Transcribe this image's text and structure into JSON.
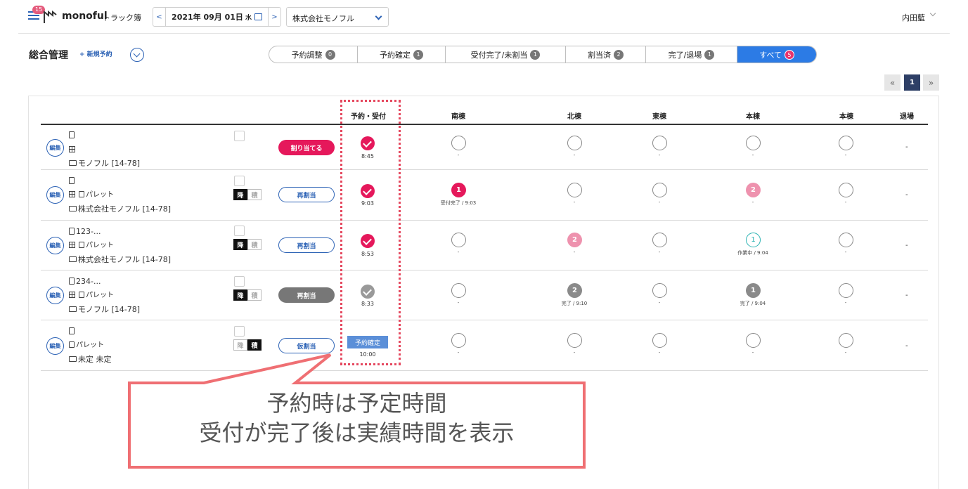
{
  "header": {
    "notification_count": "15",
    "brand": "monoful",
    "brand_sub": "トラック簿",
    "date_prev": "<",
    "date_next": ">",
    "date": "2021年 09月 01日",
    "weekday": "水",
    "company": "株式会社モノフル",
    "user": "内田藍"
  },
  "toolbar": {
    "title": "総合管理",
    "new_reservation": "+ 新規予約"
  },
  "tabs": [
    {
      "label": "予約調整",
      "count": "0"
    },
    {
      "label": "予約確定",
      "count": "1"
    },
    {
      "label": "受付完了/未割当",
      "count": "1"
    },
    {
      "label": "割当済",
      "count": "2"
    },
    {
      "label": "完了/退場",
      "count": "1"
    },
    {
      "label": "すべて",
      "count": "5"
    }
  ],
  "pager": {
    "first": "«",
    "current": "1",
    "last": "»"
  },
  "columns": [
    "予約・受付",
    "南棟",
    "北棟",
    "東棟",
    "本棟",
    "本棟",
    "退場"
  ],
  "rows": [
    {
      "edit": "編集",
      "doc": "",
      "grid": "",
      "pallet": "",
      "company": "モノフル [14-78]",
      "action": "割り当てる",
      "reception_time": "8:45",
      "cells": [
        {
          "status": "",
          "sub": "-"
        },
        {
          "status": "",
          "sub": "-"
        },
        {
          "status": "",
          "sub": "-"
        },
        {
          "status": "",
          "sub": "-"
        },
        {
          "status": "",
          "sub": "-"
        }
      ],
      "exit": "-"
    },
    {
      "edit": "編集",
      "doc": "",
      "grid": "",
      "pallet": "パレット",
      "company": "株式会社モノフル [14-78]",
      "unload": "降",
      "load": "積",
      "action": "再割当",
      "reception_time": "9:03",
      "cells": [
        {
          "num": "1",
          "sub": "受付完了 / 9:03"
        },
        {
          "status": "",
          "sub": "-"
        },
        {
          "status": "",
          "sub": "-"
        },
        {
          "num": "2",
          "sub": "-"
        },
        {
          "status": "",
          "sub": "-"
        }
      ],
      "exit": "-"
    },
    {
      "edit": "編集",
      "doc": "123-...",
      "grid": "",
      "pallet": "パレット",
      "company": "株式会社モノフル [14-78]",
      "unload": "降",
      "load": "積",
      "action": "再割当",
      "reception_time": "8:53",
      "cells": [
        {
          "status": "",
          "sub": "-"
        },
        {
          "num": "2",
          "sub": "-"
        },
        {
          "status": "",
          "sub": "-"
        },
        {
          "num": "1",
          "sub": "作業中 / 9:04"
        },
        {
          "status": "",
          "sub": "-"
        }
      ],
      "exit": "-"
    },
    {
      "edit": "編集",
      "doc": "234-...",
      "grid": "",
      "pallet": "パレット",
      "company": "モノフル [14-78]",
      "unload": "降",
      "load": "積",
      "action": "再割当",
      "reception_time": "8:33",
      "cells": [
        {
          "status": "",
          "sub": "-"
        },
        {
          "num": "2",
          "sub": "完了 / 9:10"
        },
        {
          "status": "",
          "sub": "-"
        },
        {
          "num": "1",
          "sub": "完了 / 9:04"
        },
        {
          "status": "",
          "sub": "-"
        }
      ],
      "exit": "-"
    },
    {
      "edit": "編集",
      "doc": "",
      "pallet": "パレット",
      "company": "未定 未定",
      "unload": "降",
      "load": "積",
      "action": "仮割当",
      "reception_label": "予約確定",
      "reception_time": "10:00",
      "cells": [
        {
          "status": "",
          "sub": "-"
        },
        {
          "status": "",
          "sub": "-"
        },
        {
          "status": "",
          "sub": "-"
        },
        {
          "status": "",
          "sub": "-"
        },
        {
          "status": "",
          "sub": "-"
        }
      ],
      "exit": "-"
    }
  ],
  "callout": {
    "line1": "予約時は予定時間",
    "line2": "受付が完了後は実績時間を表示"
  },
  "colors": {
    "accent": "#2c62b5",
    "active_tab": "#2c7be5",
    "pink": "#e5185b",
    "callout": "#ef6f73"
  }
}
